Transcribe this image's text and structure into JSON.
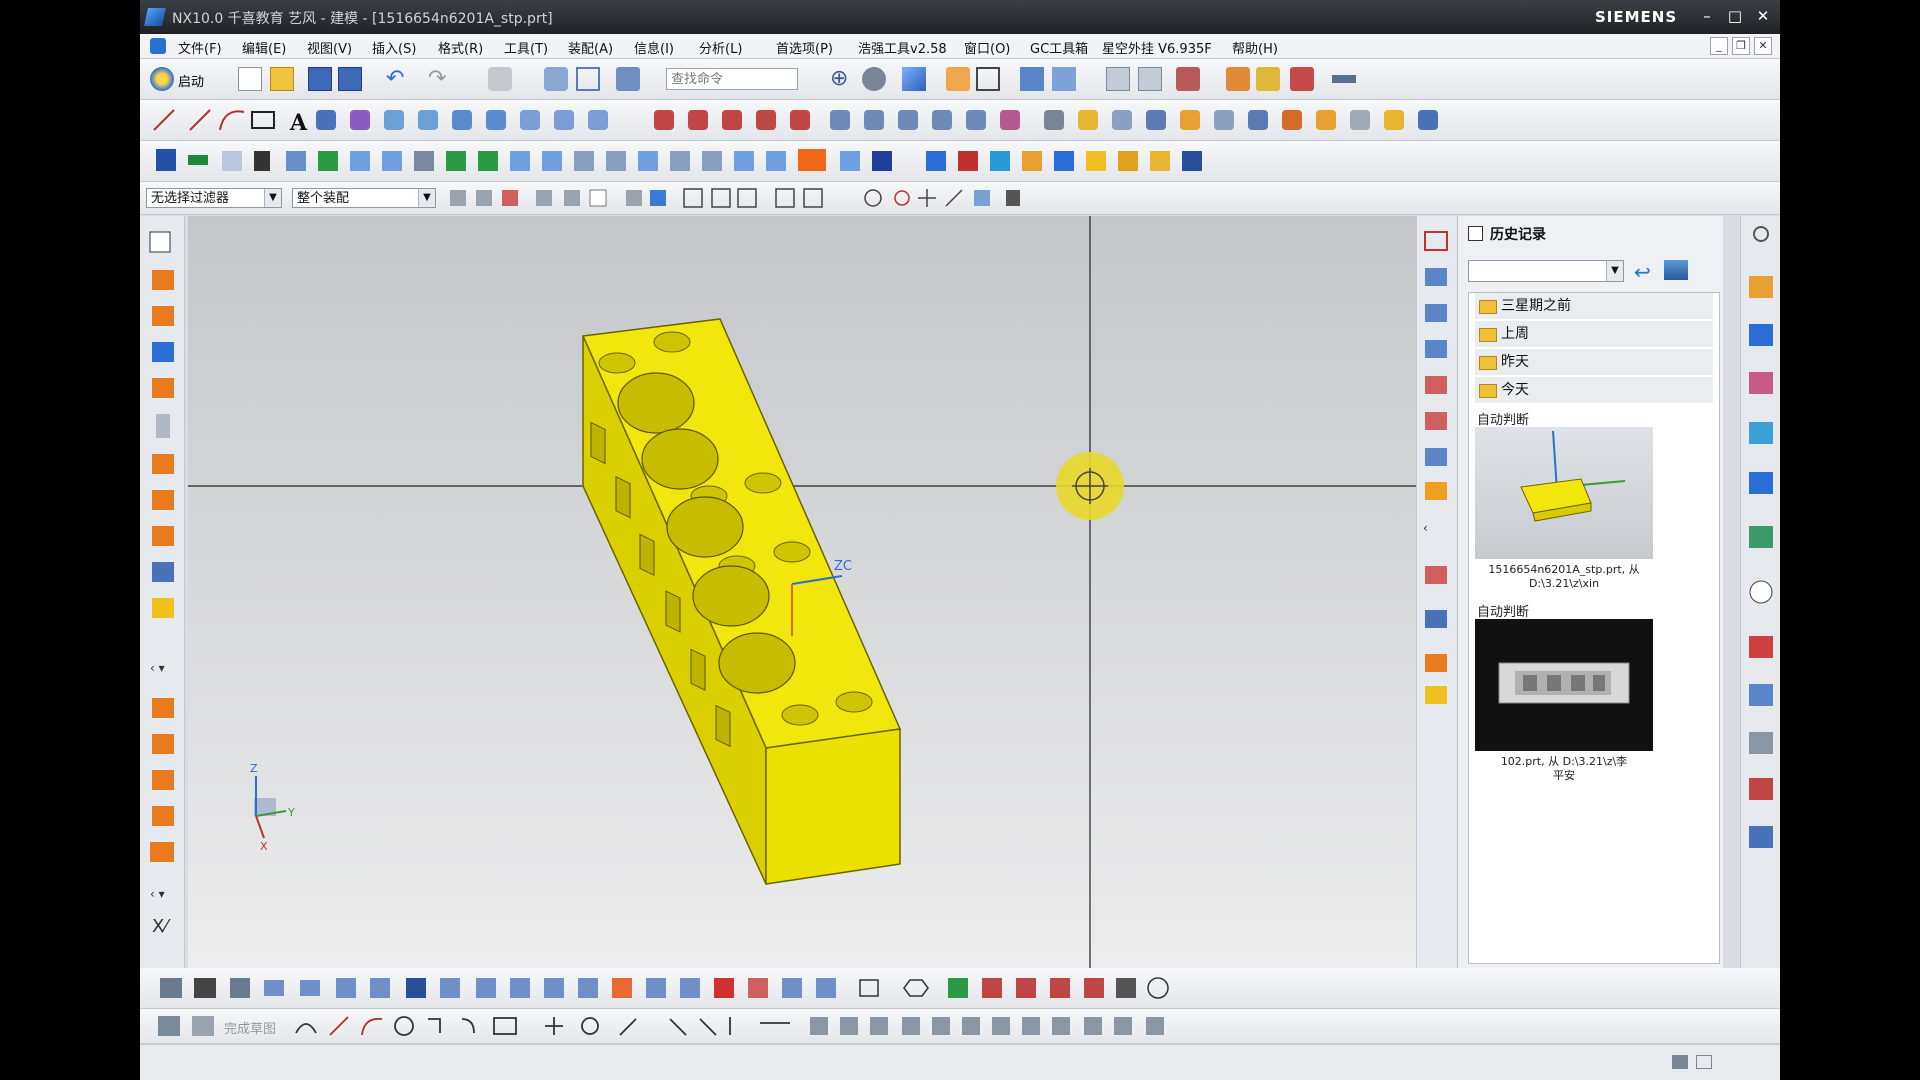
{
  "window": {
    "title": "NX10.0 千喜教育 艺风 - 建模 - [1516654n6201A_stp.prt]",
    "brand": "SIEMENS"
  },
  "menu": [
    "文件(F)",
    "编辑(E)",
    "视图(V)",
    "插入(S)",
    "格式(R)",
    "工具(T)",
    "装配(A)",
    "信息(I)",
    "分析(L)",
    "首选项(P)",
    "浩强工具v2.58",
    "窗口(O)",
    "GC工具箱",
    "星空外挂 V6.935F",
    "帮助(H)"
  ],
  "toolbar": {
    "start_label": "启动",
    "search_placeholder": "查找命令"
  },
  "selection": {
    "filter": "无选择过滤器",
    "scope": "整个装配"
  },
  "viewport": {
    "zc_label": "ZC",
    "triad_z": "Z",
    "triad_y": "Y",
    "triad_x": "X"
  },
  "history": {
    "title": "历史记录",
    "groups": [
      "三星期之前",
      "上周",
      "昨天",
      "今天"
    ],
    "entries": [
      {
        "label": "自动判断",
        "caption_line1": "1516654n6201A_stp.prt, 从",
        "caption_line2": "D:\\3.21\\z\\xin"
      },
      {
        "label": "自动判断",
        "caption_line1": "102.prt, 从 D:\\3.21\\z\\李",
        "caption_line2": "平安"
      }
    ]
  },
  "colors": {
    "part": "#f2e60c",
    "accent": "#2a6fd6"
  },
  "sketch_label": "完成草图"
}
